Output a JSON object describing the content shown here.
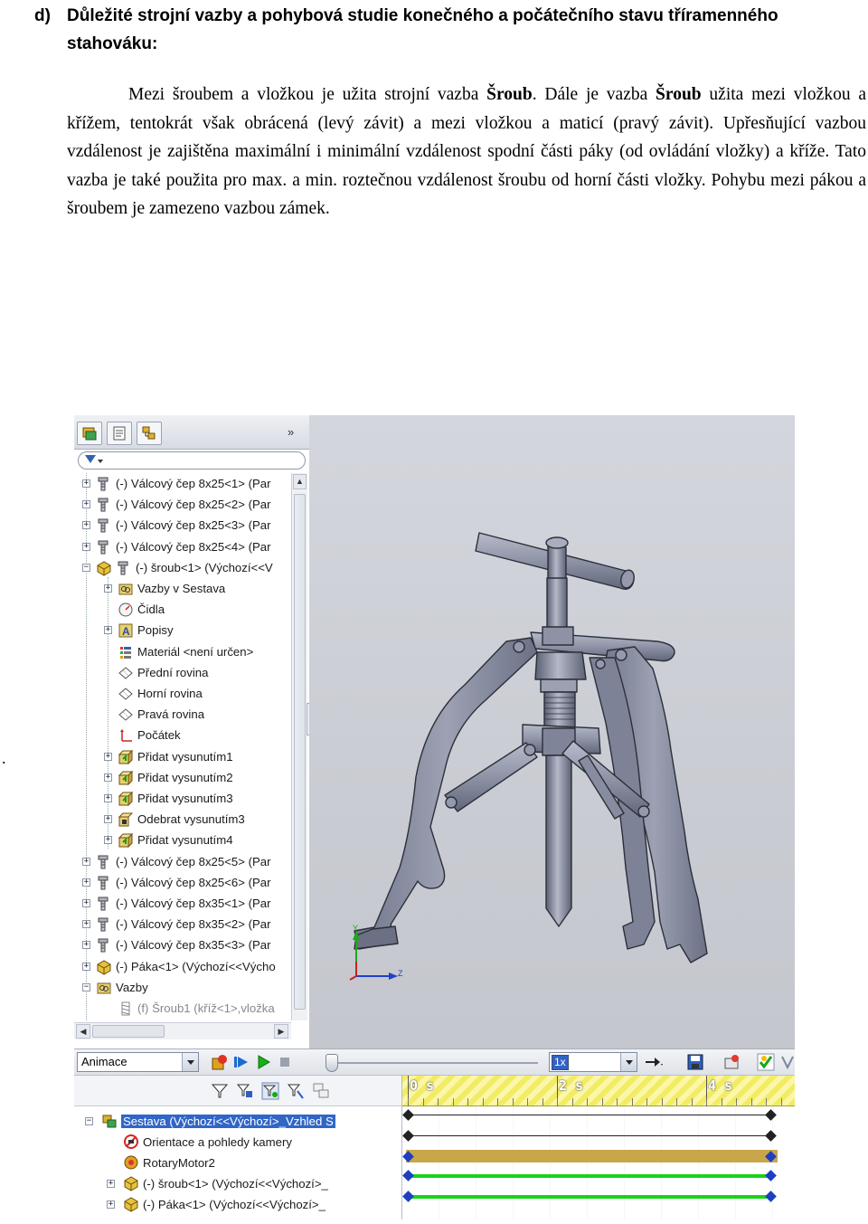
{
  "document": {
    "heading_label": "d)",
    "heading_text": "Důležité strojní vazby a pohybová studie konečného a počátečního stavu tříramenného stahováku:",
    "paragraph": [
      {
        "t": "Mezi šroubem a vložkou je užita strojní vazba "
      },
      {
        "t": "Šroub",
        "b": true
      },
      {
        "t": ". Dále je vazba "
      },
      {
        "t": "Šroub",
        "b": true
      },
      {
        "t": " užita mezi vložkou a křížem, tentokrát však obrácená (levý závit) a mezi vložkou a maticí (pravý závit). Upřesňující vazbou vzdálenost je zajištěna maximální i minimální vzdálenost spodní části páky (od ovládání vložky) a kříže. Tato vazba je také použita pro max. a min. roztečnou vzdálenost šroubu od horní části vložky. Pohybu mezi pákou a šroubem je zamezeno vazbou zámek."
      }
    ],
    "stray_dot": "."
  },
  "feature_tree": {
    "items": [
      {
        "label": "(-) Válcový čep 8x25<1> (Par",
        "icon": "pin-part-icon"
      },
      {
        "label": "(-) Válcový čep 8x25<2> (Par",
        "icon": "pin-part-icon"
      },
      {
        "label": "(-) Válcový čep 8x25<3> (Par",
        "icon": "pin-part-icon"
      },
      {
        "label": "(-) Válcový čep 8x25<4> (Par",
        "icon": "pin-part-icon"
      },
      {
        "label": "(-) šroub<1> (Výchozí<<V",
        "icon": "part-icon"
      },
      {
        "label": "Vazby v Sestava",
        "icon": "mates-folder-icon"
      },
      {
        "label": "Čidla",
        "icon": "sensor-icon"
      },
      {
        "label": "Popisy",
        "icon": "annotations-icon"
      },
      {
        "label": "Materiál <není určen>",
        "icon": "material-icon"
      },
      {
        "label": "Přední rovina",
        "icon": "plane-icon"
      },
      {
        "label": "Horní rovina",
        "icon": "plane-icon"
      },
      {
        "label": "Pravá rovina",
        "icon": "plane-icon"
      },
      {
        "label": "Počátek",
        "icon": "origin-icon"
      },
      {
        "label": "Přidat vysunutím1",
        "icon": "extrude-icon"
      },
      {
        "label": "Přidat vysunutím2",
        "icon": "extrude-icon"
      },
      {
        "label": "Přidat vysunutím3",
        "icon": "extrude-icon"
      },
      {
        "label": "Odebrat vysunutím3",
        "icon": "cut-extrude-icon"
      },
      {
        "label": "Přidat vysunutím4",
        "icon": "extrude-icon"
      },
      {
        "label": "(-) Válcový čep 8x25<5> (Par",
        "icon": "pin-part-icon"
      },
      {
        "label": "(-) Válcový čep 8x25<6> (Par",
        "icon": "pin-part-icon"
      },
      {
        "label": "(-) Válcový čep 8x35<1> (Par",
        "icon": "pin-part-icon"
      },
      {
        "label": "(-) Válcový čep 8x35<2> (Par",
        "icon": "pin-part-icon"
      },
      {
        "label": "(-) Válcový čep 8x35<3> (Par",
        "icon": "pin-part-icon"
      },
      {
        "label": "(-) Páka<1> (Výchozí<<Výcho",
        "icon": "part-icon"
      },
      {
        "label": "Vazby",
        "icon": "mates-folder-icon"
      },
      {
        "label": "(f) Šroub1 (kříž<1>,vložka",
        "icon": "screw-mate-icon"
      }
    ]
  },
  "axis_triad": {
    "y": "Y",
    "z": "Z"
  },
  "motion_manager": {
    "study_type": "Animace",
    "speed": "1x",
    "time_labels": [
      "0 s",
      "2 s",
      "4 s"
    ],
    "tree": [
      {
        "label": "Sestava  (Výchozí<<Výchozí>_Vzhled S",
        "selected": true
      },
      {
        "label": "Orientace a pohledy kamery"
      },
      {
        "label": "RotaryMotor2"
      },
      {
        "label": "(-) šroub<1> (Výchozí<<Výchozí>_"
      },
      {
        "label": "(-) Páka<1> (Výchozí<<Výchozí>_"
      }
    ]
  },
  "colors": {
    "timeline_gold": "#c9a64a",
    "timeline_green": "#17d417",
    "key_blue": "#1f3fc0",
    "selection_blue": "#3166c7",
    "part_gray": "#8c90a4"
  }
}
